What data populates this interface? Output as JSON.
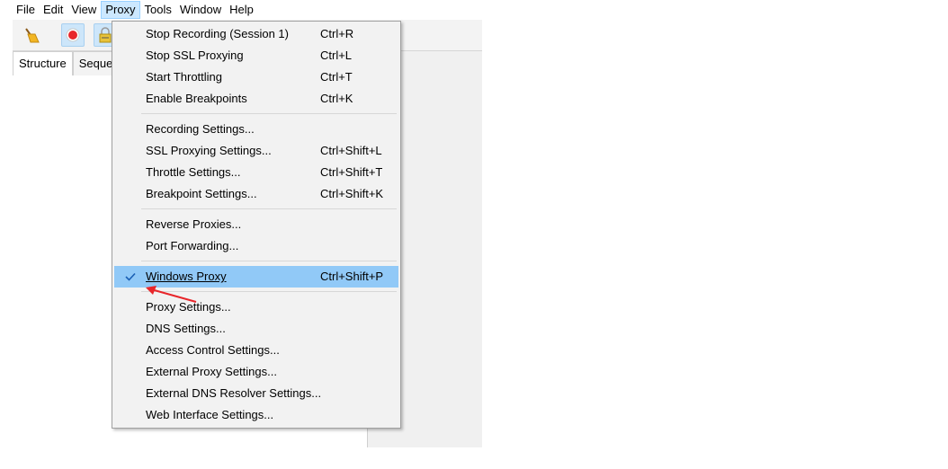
{
  "menubar": {
    "items": [
      {
        "label": "File",
        "active": false
      },
      {
        "label": "Edit",
        "active": false
      },
      {
        "label": "View",
        "active": false
      },
      {
        "label": "Proxy",
        "active": true
      },
      {
        "label": "Tools",
        "active": false
      },
      {
        "label": "Window",
        "active": false
      },
      {
        "label": "Help",
        "active": false
      }
    ]
  },
  "toolbar": {
    "icons": [
      "broom-icon",
      "record-icon",
      "lock-icon"
    ]
  },
  "tabs": [
    "Structure",
    "Seque"
  ],
  "proxy_menu": {
    "items": [
      {
        "label": "Stop Recording (Session 1)",
        "shortcut": "Ctrl+R"
      },
      {
        "label": "Stop SSL Proxying",
        "shortcut": "Ctrl+L"
      },
      {
        "label": "Start Throttling",
        "shortcut": "Ctrl+T"
      },
      {
        "label": "Enable Breakpoints",
        "shortcut": "Ctrl+K"
      },
      {
        "label": "Recording Settings...",
        "shortcut": ""
      },
      {
        "label": "SSL Proxying Settings...",
        "shortcut": "Ctrl+Shift+L"
      },
      {
        "label": "Throttle Settings...",
        "shortcut": "Ctrl+Shift+T"
      },
      {
        "label": "Breakpoint Settings...",
        "shortcut": "Ctrl+Shift+K"
      },
      {
        "label": "Reverse Proxies...",
        "shortcut": ""
      },
      {
        "label": "Port Forwarding...",
        "shortcut": ""
      },
      {
        "label": "Windows Proxy",
        "shortcut": "Ctrl+Shift+P",
        "checked": true
      },
      {
        "label": "Proxy Settings...",
        "shortcut": ""
      },
      {
        "label": "DNS Settings...",
        "shortcut": ""
      },
      {
        "label": "Access Control Settings...",
        "shortcut": ""
      },
      {
        "label": "External Proxy Settings...",
        "shortcut": ""
      },
      {
        "label": "External DNS Resolver Settings...",
        "shortcut": ""
      },
      {
        "label": "Web Interface Settings...",
        "shortcut": ""
      }
    ]
  },
  "colors": {
    "highlight": "#91c9f7",
    "active_menu": "#cce8ff",
    "annotation_arrow": "#e8262b"
  }
}
